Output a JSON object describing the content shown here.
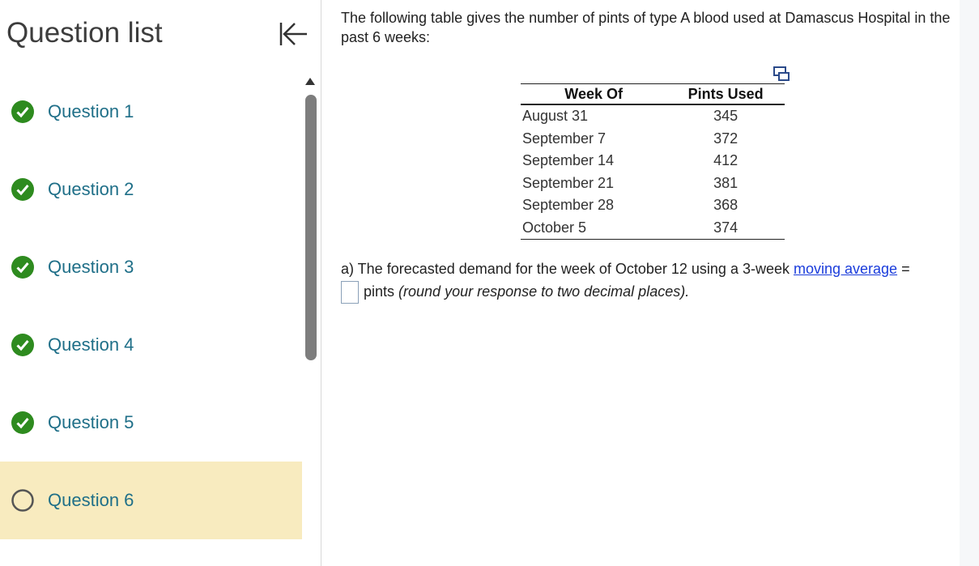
{
  "sidebar": {
    "title": "Question list",
    "items": [
      {
        "label": "Question 1",
        "status": "complete"
      },
      {
        "label": "Question 2",
        "status": "complete"
      },
      {
        "label": "Question 3",
        "status": "complete"
      },
      {
        "label": "Question 4",
        "status": "complete"
      },
      {
        "label": "Question 5",
        "status": "complete"
      },
      {
        "label": "Question 6",
        "status": "current"
      }
    ]
  },
  "question": {
    "intro": "The following table gives the number of pints of type A blood used at Damascus Hospital in the past 6 weeks:",
    "table": {
      "headers": [
        "Week Of",
        "Pints Used"
      ],
      "rows": [
        [
          "August 31",
          "345"
        ],
        [
          "September 7",
          "372"
        ],
        [
          "September 14",
          "412"
        ],
        [
          "September 21",
          "381"
        ],
        [
          "September 28",
          "368"
        ],
        [
          "October 5",
          "374"
        ]
      ]
    },
    "part_a": {
      "prefix": "a) The forecasted demand for the week of October 12 using a 3-week ",
      "link": "moving average",
      "equals": " =",
      "answer_value": "",
      "unit": "pints ",
      "hint": "(round your response to two decimal places)."
    }
  },
  "colors": {
    "check_green": "#2e8b1f",
    "link_teal": "#1f6f88",
    "highlight": "#f8ebbf",
    "link_blue": "#1a3cdb"
  },
  "icons": {
    "complete": "check-circle-icon",
    "current": "empty-circle-icon",
    "collapse": "collapse-left-icon",
    "popout": "popout-icon"
  }
}
